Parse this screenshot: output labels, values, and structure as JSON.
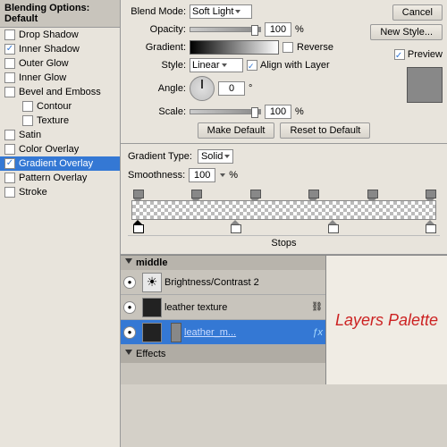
{
  "leftPanel": {
    "header": "Blending Options: Default",
    "items": [
      {
        "id": "drop-shadow",
        "label": "Drop Shadow",
        "checked": false
      },
      {
        "id": "inner-shadow",
        "label": "Inner Shadow",
        "checked": true
      },
      {
        "id": "outer-glow",
        "label": "Outer Glow",
        "checked": false
      },
      {
        "id": "inner-glow",
        "label": "Inner Glow",
        "checked": false
      },
      {
        "id": "bevel-emboss",
        "label": "Bevel and Emboss",
        "checked": false
      },
      {
        "id": "contour",
        "label": "Contour",
        "checked": false,
        "indent": true
      },
      {
        "id": "texture",
        "label": "Texture",
        "checked": false,
        "indent": true
      },
      {
        "id": "satin",
        "label": "Satin",
        "checked": false
      },
      {
        "id": "color-overlay",
        "label": "Color Overlay",
        "checked": false
      },
      {
        "id": "gradient-overlay",
        "label": "Gradient Overlay",
        "checked": true,
        "selected": true
      },
      {
        "id": "pattern-overlay",
        "label": "Pattern Overlay",
        "checked": false
      },
      {
        "id": "stroke",
        "label": "Stroke",
        "checked": false
      }
    ]
  },
  "optionsPanel": {
    "blendModeLabel": "Blend Mode:",
    "blendModeValue": "Soft Light",
    "opacityLabel": "Opacity:",
    "opacityValue": "100",
    "opacityPercent": "%",
    "gradientLabel": "Gradient:",
    "reverseLabel": "Reverse",
    "styleLabel": "Style:",
    "styleValue": "Linear",
    "alignLabel": "Align with Layer",
    "angleLabel": "Angle:",
    "angleDegree": "0",
    "degSign": "°",
    "scaleLabel": "Scale:",
    "scaleValue": "100",
    "scalePercent": "%",
    "makeDefaultBtn": "Make Default",
    "resetDefaultBtn": "Reset to Default"
  },
  "sideButtons": {
    "cancelLabel": "Cancel",
    "newStyleLabel": "New Style...",
    "previewLabel": "Preview"
  },
  "gradientEditor": {
    "gradientTypeLabel": "Gradient Type:",
    "gradientTypeValue": "Solid",
    "smoothnessLabel": "Smoothness:",
    "smoothnessValue": "100",
    "smoothnessPercent": "%",
    "stopsLabel": "Stops"
  },
  "layersPanel": {
    "header": "middle",
    "layers": [
      {
        "id": "brightness",
        "name": "Brightness/Contrast 2",
        "type": "adjustment",
        "hasEye": true,
        "hasLink": false
      },
      {
        "id": "leather-texture",
        "name": "leather texture",
        "type": "layer",
        "hasEye": true,
        "hasLink": true,
        "hasChain": true
      },
      {
        "id": "leather-m",
        "name": "leather_m...",
        "type": "layer",
        "hasEye": true,
        "hasLink": true,
        "hasFx": true,
        "isSelected": true
      }
    ],
    "effectsLabel": "Effects",
    "paletteText": "Layers Palette"
  }
}
